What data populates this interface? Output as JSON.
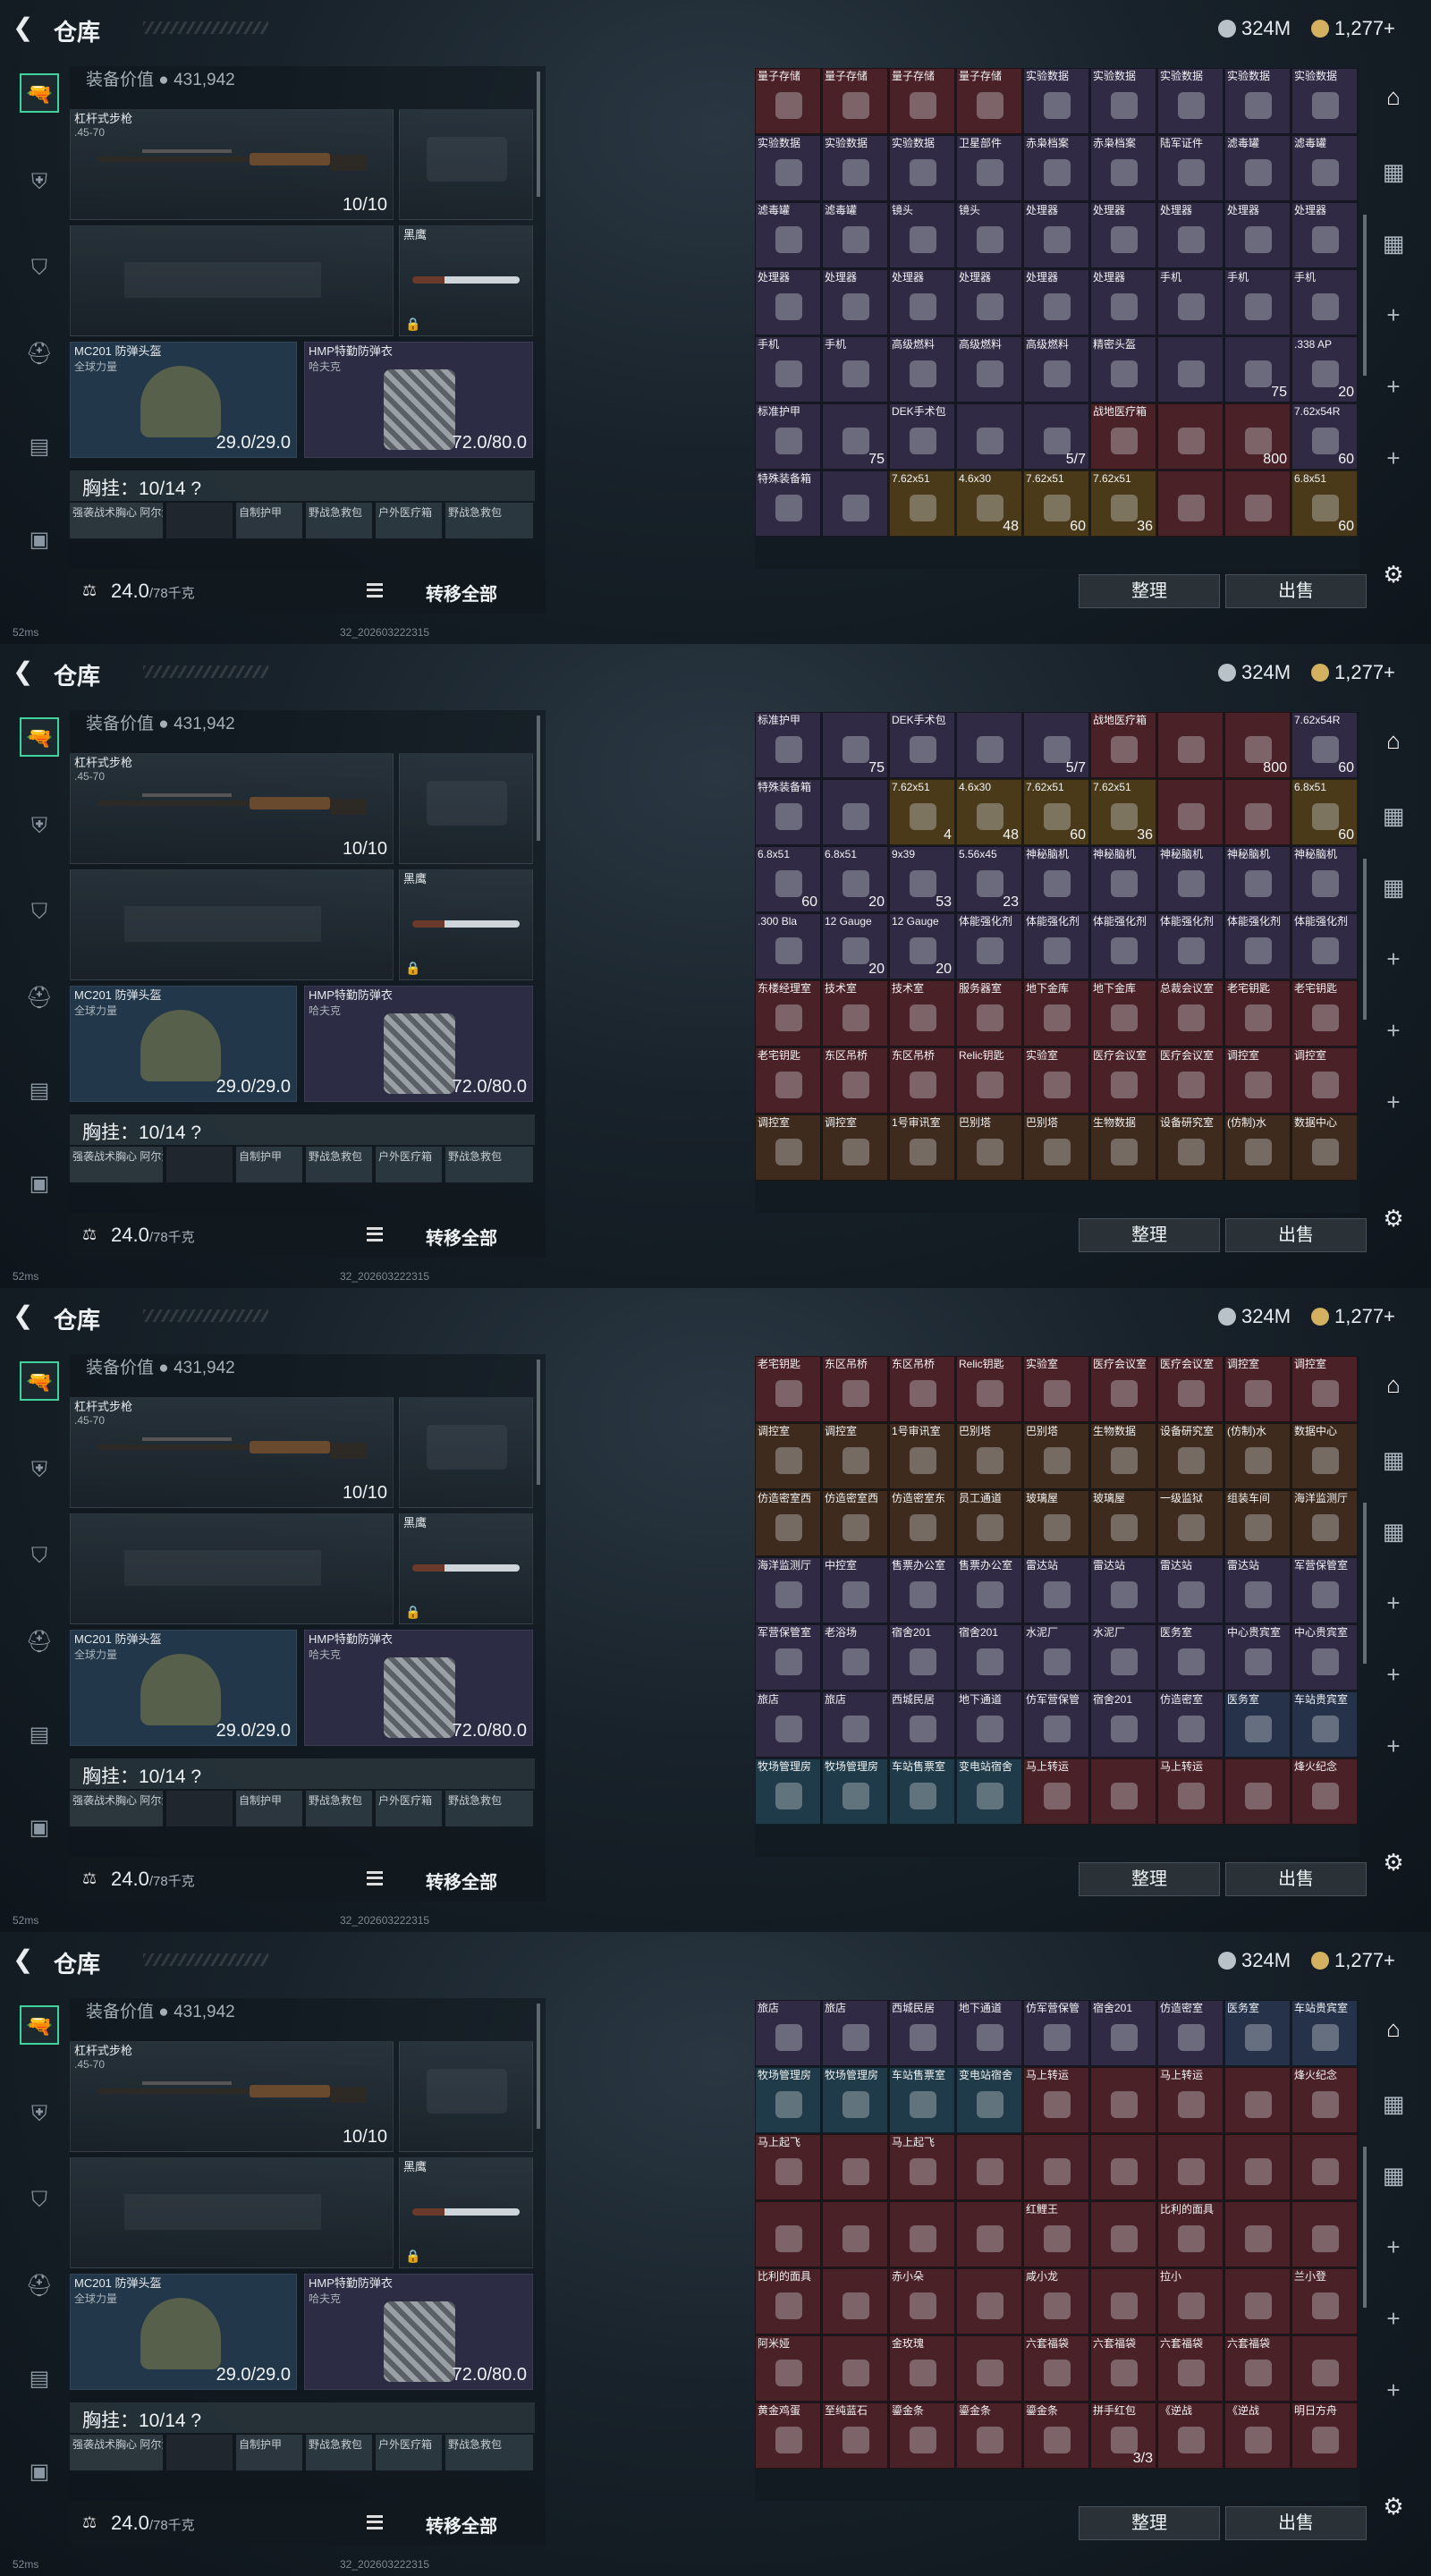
{
  "topbar": {
    "title": "仓库",
    "currency1": "324M",
    "currency2": "1,277+"
  },
  "equipment": {
    "value_label": "装备价值",
    "value": "431,942",
    "rifle": {
      "name": "杠杆式步枪",
      "sub": ".45-70",
      "ammo": "10/10"
    },
    "knife": {
      "name": "黑鹰"
    },
    "helmet": {
      "name": "MC201 防弹头盔",
      "sub": "全球力量",
      "dur": "29.0/29.0"
    },
    "vest": {
      "name": "HMP特勤防弹衣",
      "sub": "哈夫克",
      "dur": "72.0/80.0"
    },
    "chest": "胸挂：10/14 ?",
    "pouches": [
      "强袭战术胸心 阿尔法",
      "",
      "自制护甲",
      "野战急救包",
      "户外医疗箱",
      "野战急救包"
    ],
    "weight": "24.0",
    "weight_max": "/78千克",
    "transfer": "转移全部"
  },
  "buttons": {
    "sort": "整理",
    "sell": "出售"
  },
  "status": {
    "ping": "52ms",
    "version": "32_202603222315"
  },
  "icons": {
    "back": "back-arrow-icon",
    "coin1": "silver-coin-icon",
    "coin2": "gold-coin-icon"
  },
  "sidebar": [
    "gun-icon",
    "armor-icon",
    "backpack-icon",
    "helmet-icon",
    "case-icon",
    "toolbox-icon"
  ],
  "panels": [
    {
      "cells": [
        [
          "量子存储",
          "",
          "c-red"
        ],
        [
          "量子存储",
          "",
          "c-red"
        ],
        [
          "量子存储",
          "",
          "c-red"
        ],
        [
          "量子存储",
          "",
          "c-red"
        ],
        [
          "实验数据",
          "",
          "c-purple"
        ],
        [
          "实验数据",
          "",
          "c-purple"
        ],
        [
          "实验数据",
          "",
          "c-purple"
        ],
        [
          "实验数据",
          "",
          "c-purple"
        ],
        [
          "实验数据",
          "",
          "c-purple"
        ],
        [
          "实验数据",
          "",
          "c-purple"
        ],
        [
          "实验数据",
          "",
          "c-purple"
        ],
        [
          "实验数据",
          "",
          "c-purple"
        ],
        [
          "卫星部件",
          "",
          "c-purple"
        ],
        [
          "赤枭档案",
          "",
          "c-purple"
        ],
        [
          "赤枭档案",
          "",
          "c-purple"
        ],
        [
          "陆军证件",
          "",
          "c-purple"
        ],
        [
          "滤毒罐",
          "",
          "c-purple"
        ],
        [
          "滤毒罐",
          "",
          "c-purple"
        ],
        [
          "滤毒罐",
          "",
          "c-purple"
        ],
        [
          "滤毒罐",
          "",
          "c-purple"
        ],
        [
          "镜头",
          "",
          "c-purple"
        ],
        [
          "镜头",
          "",
          "c-purple"
        ],
        [
          "处理器",
          "",
          "c-purple"
        ],
        [
          "处理器",
          "",
          "c-purple"
        ],
        [
          "处理器",
          "",
          "c-purple"
        ],
        [
          "处理器",
          "",
          "c-purple"
        ],
        [
          "处理器",
          "",
          "c-purple"
        ],
        [
          "处理器",
          "",
          "c-purple"
        ],
        [
          "处理器",
          "",
          "c-purple"
        ],
        [
          "处理器",
          "",
          "c-purple"
        ],
        [
          "处理器",
          "",
          "c-purple"
        ],
        [
          "处理器",
          "",
          "c-purple"
        ],
        [
          "处理器",
          "",
          "c-purple"
        ],
        [
          "手机",
          "",
          "c-purple"
        ],
        [
          "手机",
          "",
          "c-purple"
        ],
        [
          "手机",
          "",
          "c-purple"
        ],
        [
          "手机",
          "",
          "c-purple"
        ],
        [
          "手机",
          "",
          "c-purple"
        ],
        [
          "高级燃料",
          "",
          "c-purple"
        ],
        [
          "高级燃料",
          "",
          "c-purple"
        ],
        [
          "高级燃料",
          "",
          "c-purple"
        ],
        [
          "精密头盔",
          "",
          "c-purple"
        ],
        [
          "",
          "",
          "c-purple"
        ],
        [
          "",
          "75",
          "c-purple"
        ],
        [
          ".338 AP",
          "20",
          "c-purple"
        ],
        [
          "标准护甲",
          "",
          "c-purple"
        ],
        [
          "",
          "75",
          "c-purple"
        ],
        [
          "DEK手术包",
          "",
          "c-purple"
        ],
        [
          "",
          "",
          "c-purple"
        ],
        [
          "",
          "5/7",
          "c-purple"
        ],
        [
          "战地医疗箱",
          "",
          "c-red"
        ],
        [
          "",
          "",
          "c-red"
        ],
        [
          "",
          "800",
          "c-red"
        ],
        [
          "7.62x54R",
          "60",
          "c-purple"
        ],
        [
          "特殊装备箱",
          "",
          "c-purple"
        ],
        [
          "",
          "",
          "c-purple"
        ],
        [
          "7.62x51",
          "",
          "c-gold"
        ],
        [
          "4.6x30",
          "48",
          "c-gold"
        ],
        [
          "7.62x51",
          "60",
          "c-gold"
        ],
        [
          "7.62x51",
          "36",
          "c-gold"
        ],
        [
          "",
          "",
          "c-red"
        ],
        [
          "",
          "",
          "c-red"
        ],
        [
          "6.8x51",
          "60",
          "c-gold"
        ]
      ]
    },
    {
      "cells": [
        [
          "标准护甲",
          "",
          "c-purple"
        ],
        [
          "",
          "75",
          "c-purple"
        ],
        [
          "DEK手术包",
          "",
          "c-purple"
        ],
        [
          "",
          "",
          "c-purple"
        ],
        [
          "",
          "5/7",
          "c-purple"
        ],
        [
          "战地医疗箱",
          "",
          "c-red"
        ],
        [
          "",
          "",
          "c-red"
        ],
        [
          "",
          "800",
          "c-red"
        ],
        [
          "7.62x54R",
          "60",
          "c-purple"
        ],
        [
          "特殊装备箱",
          "",
          "c-purple"
        ],
        [
          "",
          "",
          "c-purple"
        ],
        [
          "7.62x51",
          "4",
          "c-gold"
        ],
        [
          "4.6x30",
          "48",
          "c-gold"
        ],
        [
          "7.62x51",
          "60",
          "c-gold"
        ],
        [
          "7.62x51",
          "36",
          "c-gold"
        ],
        [
          "",
          "",
          "c-red"
        ],
        [
          "",
          "",
          "c-red"
        ],
        [
          "6.8x51",
          "60",
          "c-gold"
        ],
        [
          "6.8x51",
          "60",
          "c-purple"
        ],
        [
          "6.8x51",
          "20",
          "c-purple"
        ],
        [
          "9x39",
          "53",
          "c-purple"
        ],
        [
          "5.56x45",
          "23",
          "c-purple"
        ],
        [
          "神秘脑机",
          "",
          "c-purple"
        ],
        [
          "神秘脑机",
          "",
          "c-purple"
        ],
        [
          "神秘脑机",
          "",
          "c-purple"
        ],
        [
          "神秘脑机",
          "",
          "c-purple"
        ],
        [
          "神秘脑机",
          "",
          "c-purple"
        ],
        [
          ".300 Bla",
          "",
          "c-purple"
        ],
        [
          "12 Gauge",
          "20",
          "c-purple"
        ],
        [
          "12 Gauge",
          "20",
          "c-purple"
        ],
        [
          "体能强化剂",
          "",
          "c-purple"
        ],
        [
          "体能强化剂",
          "",
          "c-purple"
        ],
        [
          "体能强化剂",
          "",
          "c-purple"
        ],
        [
          "体能强化剂",
          "",
          "c-purple"
        ],
        [
          "体能强化剂",
          "",
          "c-purple"
        ],
        [
          "体能强化剂",
          "",
          "c-purple"
        ],
        [
          "东楼经理室",
          "",
          "c-red"
        ],
        [
          "技术室",
          "",
          "c-red"
        ],
        [
          "技术室",
          "",
          "c-red"
        ],
        [
          "服务器室",
          "",
          "c-red"
        ],
        [
          "地下金库",
          "",
          "c-red"
        ],
        [
          "地下金库",
          "",
          "c-red"
        ],
        [
          "总裁会议室",
          "",
          "c-red"
        ],
        [
          "老宅钥匙",
          "",
          "c-red"
        ],
        [
          "老宅钥匙",
          "",
          "c-red"
        ],
        [
          "老宅钥匙",
          "",
          "c-red"
        ],
        [
          "东区吊桥",
          "",
          "c-red"
        ],
        [
          "东区吊桥",
          "",
          "c-red"
        ],
        [
          "Relic钥匙",
          "",
          "c-red"
        ],
        [
          "实验室",
          "",
          "c-red"
        ],
        [
          "医疗会议室",
          "",
          "c-red"
        ],
        [
          "医疗会议室",
          "",
          "c-red"
        ],
        [
          "调控室",
          "",
          "c-red"
        ],
        [
          "调控室",
          "",
          "c-red"
        ],
        [
          "调控室",
          "",
          "c-brown"
        ],
        [
          "调控室",
          "",
          "c-brown"
        ],
        [
          "1号审讯室",
          "",
          "c-brown"
        ],
        [
          "巴别塔",
          "",
          "c-brown"
        ],
        [
          "巴别塔",
          "",
          "c-brown"
        ],
        [
          "生物数据",
          "",
          "c-brown"
        ],
        [
          "设备研究室",
          "",
          "c-brown"
        ],
        [
          "(仿制)水",
          "",
          "c-brown"
        ],
        [
          "数据中心",
          "",
          "c-brown"
        ]
      ]
    },
    {
      "cells": [
        [
          "老宅钥匙",
          "",
          "c-red"
        ],
        [
          "东区吊桥",
          "",
          "c-red"
        ],
        [
          "东区吊桥",
          "",
          "c-red"
        ],
        [
          "Relic钥匙",
          "",
          "c-red"
        ],
        [
          "实验室",
          "",
          "c-red"
        ],
        [
          "医疗会议室",
          "",
          "c-red"
        ],
        [
          "医疗会议室",
          "",
          "c-red"
        ],
        [
          "调控室",
          "",
          "c-red"
        ],
        [
          "调控室",
          "",
          "c-red"
        ],
        [
          "调控室",
          "",
          "c-brown"
        ],
        [
          "调控室",
          "",
          "c-brown"
        ],
        [
          "1号审讯室",
          "",
          "c-brown"
        ],
        [
          "巴别塔",
          "",
          "c-brown"
        ],
        [
          "巴别塔",
          "",
          "c-brown"
        ],
        [
          "生物数据",
          "",
          "c-brown"
        ],
        [
          "设备研究室",
          "",
          "c-brown"
        ],
        [
          "(仿制)水",
          "",
          "c-brown"
        ],
        [
          "数据中心",
          "",
          "c-brown"
        ],
        [
          "仿造密室西",
          "",
          "c-brown"
        ],
        [
          "仿造密室西",
          "",
          "c-brown"
        ],
        [
          "仿造密室东",
          "",
          "c-brown"
        ],
        [
          "员工通道",
          "",
          "c-brown"
        ],
        [
          "玻璃屋",
          "",
          "c-brown"
        ],
        [
          "玻璃屋",
          "",
          "c-brown"
        ],
        [
          "一级监狱",
          "",
          "c-brown"
        ],
        [
          "组装车间",
          "",
          "c-brown"
        ],
        [
          "海洋监测厅",
          "",
          "c-brown"
        ],
        [
          "海洋监测厅",
          "",
          "c-purple"
        ],
        [
          "中控室",
          "",
          "c-purple"
        ],
        [
          "售票办公室",
          "",
          "c-purple"
        ],
        [
          "售票办公室",
          "",
          "c-purple"
        ],
        [
          "雷达站",
          "",
          "c-purple"
        ],
        [
          "雷达站",
          "",
          "c-purple"
        ],
        [
          "雷达站",
          "",
          "c-purple"
        ],
        [
          "雷达站",
          "",
          "c-purple"
        ],
        [
          "军营保管室",
          "",
          "c-purple"
        ],
        [
          "军营保管室",
          "",
          "c-purple"
        ],
        [
          "老浴场",
          "",
          "c-purple"
        ],
        [
          "宿舍201",
          "",
          "c-purple"
        ],
        [
          "宿舍201",
          "",
          "c-purple"
        ],
        [
          "水泥厂",
          "",
          "c-purple"
        ],
        [
          "水泥厂",
          "",
          "c-purple"
        ],
        [
          "医务室",
          "",
          "c-purple"
        ],
        [
          "中心贵宾室",
          "",
          "c-purple"
        ],
        [
          "中心贵宾室",
          "",
          "c-purple"
        ],
        [
          "旅店",
          "",
          "c-purple"
        ],
        [
          "旅店",
          "",
          "c-purple"
        ],
        [
          "西城民居",
          "",
          "c-purple"
        ],
        [
          "地下通道",
          "",
          "c-purple"
        ],
        [
          "仿军营保管",
          "",
          "c-purple"
        ],
        [
          "宿舍201",
          "",
          "c-purple"
        ],
        [
          "仿造密室",
          "",
          "c-purple"
        ],
        [
          "医务室",
          "",
          "c-blue"
        ],
        [
          "车站贵宾室",
          "",
          "c-blue"
        ],
        [
          "牧场管理房",
          "",
          "c-teal"
        ],
        [
          "牧场管理房",
          "",
          "c-teal"
        ],
        [
          "车站售票室",
          "",
          "c-teal"
        ],
        [
          "变电站宿舍",
          "",
          "c-teal"
        ],
        [
          "马上转运",
          "",
          "c-red"
        ],
        [
          "",
          "",
          "c-red"
        ],
        [
          "马上转运",
          "",
          "c-red"
        ],
        [
          "",
          "",
          "c-red"
        ],
        [
          "烽火纪念",
          "",
          "c-red"
        ]
      ]
    },
    {
      "cells": [
        [
          "旅店",
          "",
          "c-purple"
        ],
        [
          "旅店",
          "",
          "c-purple"
        ],
        [
          "西城民居",
          "",
          "c-purple"
        ],
        [
          "地下通道",
          "",
          "c-purple"
        ],
        [
          "仿军营保管",
          "",
          "c-purple"
        ],
        [
          "宿舍201",
          "",
          "c-purple"
        ],
        [
          "仿造密室",
          "",
          "c-purple"
        ],
        [
          "医务室",
          "",
          "c-blue"
        ],
        [
          "车站贵宾室",
          "",
          "c-blue"
        ],
        [
          "牧场管理房",
          "",
          "c-teal"
        ],
        [
          "牧场管理房",
          "",
          "c-teal"
        ],
        [
          "车站售票室",
          "",
          "c-teal"
        ],
        [
          "变电站宿舍",
          "",
          "c-teal"
        ],
        [
          "马上转运",
          "",
          "c-red"
        ],
        [
          "",
          "",
          "c-red"
        ],
        [
          "马上转运",
          "",
          "c-red"
        ],
        [
          "",
          "",
          "c-red"
        ],
        [
          "烽火纪念",
          "",
          "c-red"
        ],
        [
          "马上起飞",
          "",
          "c-red"
        ],
        [
          "",
          "",
          "c-red"
        ],
        [
          "马上起飞",
          "",
          "c-red"
        ],
        [
          "",
          "",
          "c-red"
        ],
        [
          "",
          "",
          "c-red"
        ],
        [
          "",
          "",
          "c-red"
        ],
        [
          "",
          "",
          "c-red"
        ],
        [
          "",
          "",
          "c-red"
        ],
        [
          "",
          "",
          "c-red"
        ],
        [
          "",
          "",
          "c-red"
        ],
        [
          "",
          "",
          "c-red"
        ],
        [
          "",
          "",
          "c-red"
        ],
        [
          "",
          "",
          "c-red"
        ],
        [
          "红鲤王",
          "",
          "c-red"
        ],
        [
          "",
          "",
          "c-red"
        ],
        [
          "比利的面具",
          "",
          "c-red"
        ],
        [
          "",
          "",
          "c-red"
        ],
        [
          "",
          "",
          "c-red"
        ],
        [
          "比利的面具",
          "",
          "c-red"
        ],
        [
          "",
          "",
          "c-red"
        ],
        [
          "赤小朵",
          "",
          "c-red"
        ],
        [
          "",
          "",
          "c-red"
        ],
        [
          "咸小龙",
          "",
          "c-red"
        ],
        [
          "",
          "",
          "c-red"
        ],
        [
          "拉小",
          "",
          "c-red"
        ],
        [
          "",
          "",
          "c-red"
        ],
        [
          "兰小登",
          "",
          "c-red"
        ],
        [
          "阿米娅",
          "",
          "c-red"
        ],
        [
          "",
          "",
          "c-red"
        ],
        [
          "金玫瑰",
          "",
          "c-red"
        ],
        [
          "",
          "",
          "c-red"
        ],
        [
          "六套福袋",
          "",
          "c-red"
        ],
        [
          "六套福袋",
          "",
          "c-red"
        ],
        [
          "六套福袋",
          "",
          "c-red"
        ],
        [
          "六套福袋",
          "",
          "c-red"
        ],
        [
          "",
          "",
          "c-red"
        ],
        [
          "黄金鸡蛋",
          "",
          "c-red"
        ],
        [
          "至纯蓝石",
          "",
          "c-red"
        ],
        [
          "鎏金条",
          "",
          "c-red"
        ],
        [
          "鎏金条",
          "",
          "c-red"
        ],
        [
          "鎏金条",
          "",
          "c-red"
        ],
        [
          "拼手红包",
          "3/3",
          "c-red"
        ],
        [
          "《逆战",
          "",
          "c-red"
        ],
        [
          "《逆战",
          "",
          "c-red"
        ],
        [
          "明日方舟",
          "",
          "c-red"
        ]
      ]
    }
  ]
}
